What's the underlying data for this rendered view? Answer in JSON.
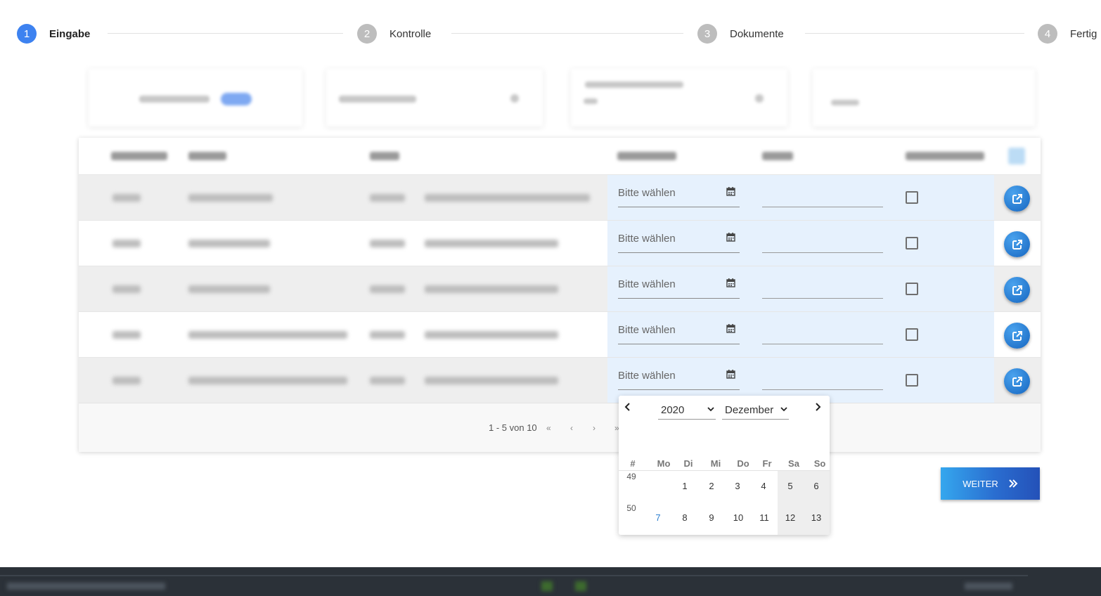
{
  "stepper": {
    "steps": [
      {
        "number": "1",
        "label": "Eingabe",
        "state": "active"
      },
      {
        "number": "2",
        "label": "Kontrolle",
        "state": "pending"
      },
      {
        "number": "3",
        "label": "Dokumente",
        "state": "pending"
      },
      {
        "number": "4",
        "label": "Fertig",
        "state": "pending"
      }
    ]
  },
  "table": {
    "rows": [
      {
        "date_placeholder": "Bitte wählen",
        "checked": false
      },
      {
        "date_placeholder": "Bitte wählen",
        "checked": false
      },
      {
        "date_placeholder": "Bitte wählen",
        "checked": false
      },
      {
        "date_placeholder": "Bitte wählen",
        "checked": false
      },
      {
        "date_placeholder": "Bitte wählen",
        "checked": false
      }
    ],
    "pagination": {
      "info": "1 - 5 von 10",
      "first": "«",
      "prev": "‹",
      "next": "›",
      "last": "»"
    }
  },
  "datepicker": {
    "year": "2020",
    "month": "Dezember",
    "week_header": "#",
    "weekdays": [
      "Mo",
      "Di",
      "Mi",
      "Do",
      "Fr",
      "Sa",
      "So"
    ],
    "weeks": [
      {
        "week": "49",
        "days": [
          "",
          "1",
          "2",
          "3",
          "4",
          "5",
          "6"
        ]
      },
      {
        "week": "50",
        "days": [
          "7",
          "8",
          "9",
          "10",
          "11",
          "12",
          "13"
        ]
      }
    ]
  },
  "actions": {
    "next_label": "WEITER"
  },
  "colors": {
    "accent": "#3d82f0",
    "row_edit_bg": "#e6f1fd",
    "button_gradient_start": "#35a7ee",
    "button_gradient_end": "#2451b8"
  }
}
